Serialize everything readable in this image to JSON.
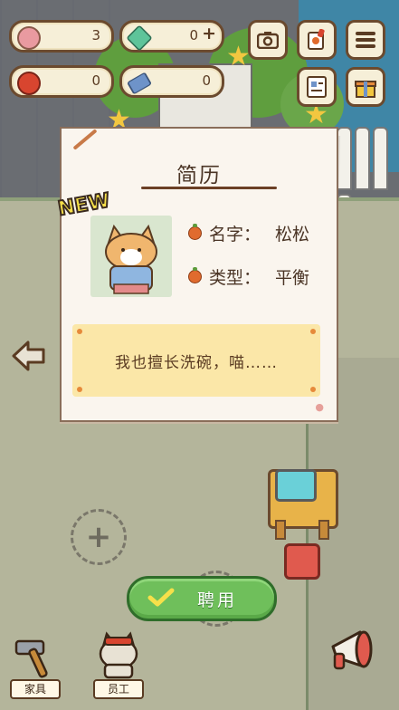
{
  "hud": {
    "resources": [
      {
        "name": "paw-coin",
        "value": "3",
        "icon": "paw-icon",
        "color": "#e99aa0"
      },
      {
        "name": "gem",
        "value": "0",
        "icon": "gem-icon",
        "color": "#5ec49a"
      },
      {
        "name": "apple",
        "value": "0",
        "icon": "apple-icon",
        "color": "#d8452f"
      },
      {
        "name": "ticket",
        "value": "0",
        "icon": "ticket-icon",
        "color": "#6e93c9"
      }
    ],
    "gem_add": "+",
    "buttons": [
      "camera-icon",
      "recipe-icon",
      "menu-icon",
      "notebook-icon",
      "gift-icon"
    ]
  },
  "card": {
    "title": "简历",
    "badge": "NEW",
    "name_label": "名字：",
    "name_value": "松松",
    "type_label": "类型：",
    "type_value": "平衡",
    "note": "我也擅长洗碗，喵……"
  },
  "hire_button": {
    "label": "聘用"
  },
  "nav": {
    "furniture": "家具",
    "staff": "员工"
  },
  "colors": {
    "accent_green": "#6fbf5b",
    "card_bg": "#faf5ee",
    "note_bg": "#fbe7a8",
    "outline": "#6b4a2e"
  }
}
